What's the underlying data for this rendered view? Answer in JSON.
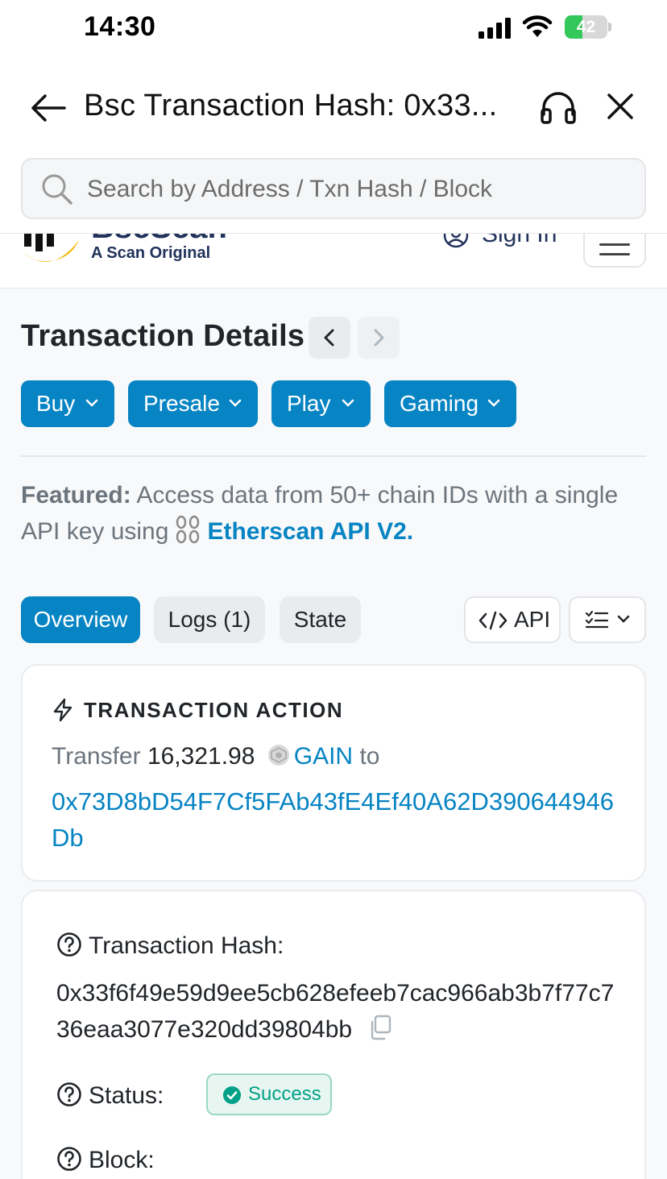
{
  "status_bar": {
    "time": "14:30",
    "battery": "42",
    "battery_level": 0.42
  },
  "browser": {
    "title": "Bsc Transaction Hash: 0x33...",
    "search_placeholder": "Search by Address / Txn Hash / Block"
  },
  "site": {
    "brand": "BscScan",
    "tagline": "A Scan Original",
    "sign_in": "Sign In"
  },
  "page": {
    "heading": "Transaction Details",
    "sponsor_buttons": [
      "Buy",
      "Presale",
      "Play",
      "Gaming"
    ],
    "featured_label": "Featured:",
    "featured_text": " Access data from 50+ chain IDs with a single API key using",
    "featured_link": "Etherscan API V2.",
    "tabs": [
      "Overview",
      "Logs (1)",
      "State"
    ],
    "api_button": "API"
  },
  "transaction_action": {
    "title": "TRANSACTION ACTION",
    "verb": "Transfer",
    "amount": "16,321.98",
    "token": "GAIN",
    "to_word": "to",
    "to_address": "0x73D8bD54F7Cf5FAb43fE4Ef40A62D390644946Db"
  },
  "details": {
    "hash_label": "Transaction Hash:",
    "hash_value": "0x33f6f49e59d9ee5cb628efeeb7cac966ab3b7f77c736eaa3077e320dd39804bb",
    "status_label": "Status:",
    "status_value": "Success",
    "block_label": "Block:"
  },
  "colors": {
    "accent": "#0784c3",
    "success": "#00a186",
    "brand_dark": "#21325b",
    "brand_yellow": "#f0b90b"
  }
}
